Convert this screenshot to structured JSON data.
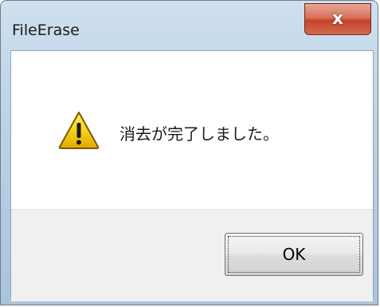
{
  "window": {
    "title": "FileErase",
    "close_label": "x"
  },
  "dialog": {
    "message": "消去が完了しました。",
    "icon": "warning-icon",
    "ok_label": "OK"
  },
  "colors": {
    "close_button": "#c2432c",
    "warning_yellow": "#f5c400"
  }
}
